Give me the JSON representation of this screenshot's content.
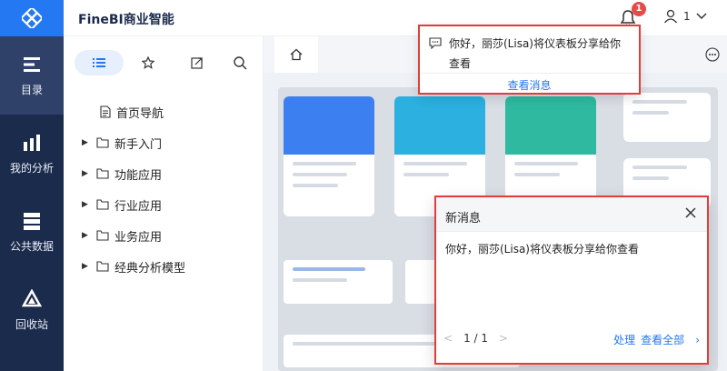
{
  "app": {
    "brand": "FineBI商业智能"
  },
  "rail": {
    "items": [
      {
        "label": "目录"
      },
      {
        "label": "我的分析"
      },
      {
        "label": "公共数据"
      },
      {
        "label": "回收站"
      }
    ]
  },
  "header": {
    "notification_count": "1",
    "user_name": "1"
  },
  "directory": {
    "items": [
      {
        "label": "首页导航"
      },
      {
        "label": "新手入门"
      },
      {
        "label": "功能应用"
      },
      {
        "label": "行业应用"
      },
      {
        "label": "业务应用"
      },
      {
        "label": "经典分析模型"
      }
    ]
  },
  "popover": {
    "message": "你好，丽莎(Lisa)将仪表板分享给你查看",
    "view_label": "查看消息"
  },
  "new_message": {
    "title": "新消息",
    "body": "你好，丽莎(Lisa)将仪表板分享给你查看",
    "pager": "1 / 1",
    "handle_label": "处理",
    "view_all_label": "查看全部"
  },
  "colors": {
    "rail": "#1b2b4c",
    "accent": "#2478f2",
    "alert": "#e43b3b"
  }
}
